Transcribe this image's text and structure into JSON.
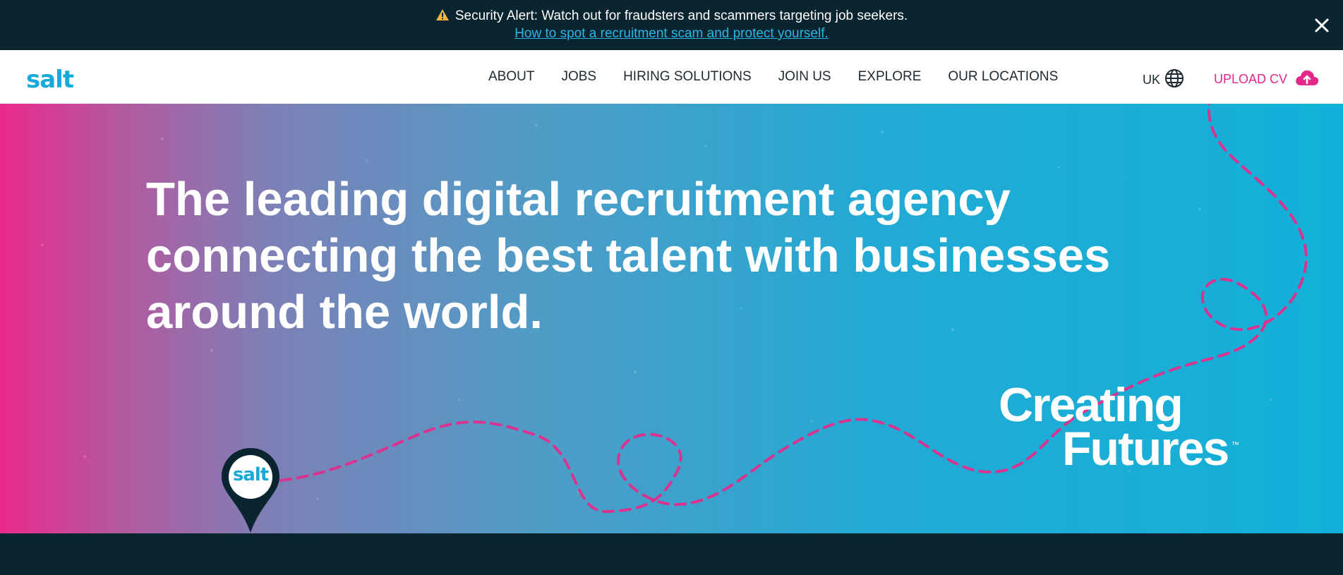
{
  "alert": {
    "message": "Security Alert: Watch out for fraudsters and scammers targeting job seekers.",
    "link_text": "How to spot a recruitment scam and protect yourself.",
    "close_icon": "close-icon",
    "warning_icon": "warning-icon"
  },
  "header": {
    "logo": "salt",
    "nav": [
      "ABOUT",
      "JOBS",
      "HIRING SOLUTIONS",
      "JOIN US",
      "EXPLORE",
      "OUR LOCATIONS"
    ],
    "region": "UK",
    "region_icon": "globe-icon",
    "upload_label": "UPLOAD CV",
    "upload_icon": "cloud-upload-icon"
  },
  "hero": {
    "headline_line1": "The leading digital recruitment agency",
    "headline_line2": "connecting the best talent with businesses",
    "headline_line3": "around the world.",
    "tagline_1": "Creating",
    "tagline_2": "Futures",
    "tagline_tm": "™",
    "pin_logo": "salt"
  },
  "colors": {
    "dark": "#0b2530",
    "brand_blue": "#17a9d8",
    "brand_pink": "#e2288a",
    "link_blue": "#29b6e6"
  }
}
